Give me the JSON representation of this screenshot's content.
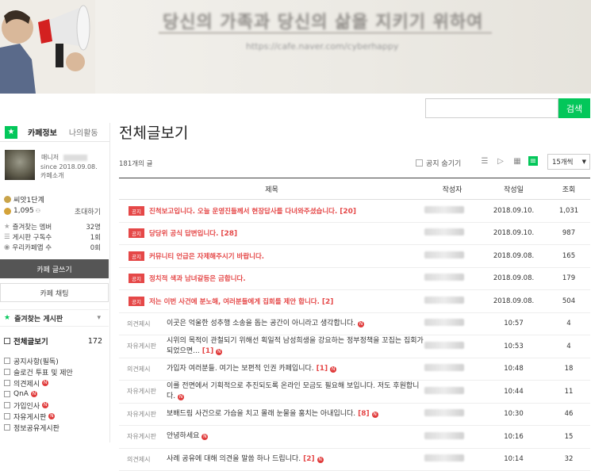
{
  "banner": {
    "title": "당신의 가족과 당신의 삶을 지키기 위하여",
    "url": "https://cafe.naver.com/cyberhappy"
  },
  "search": {
    "placeholder": "",
    "button_label": "검색"
  },
  "sidebar": {
    "tabs": [
      {
        "label": "카페정보"
      },
      {
        "label": "나의활동"
      }
    ],
    "manager_label": "매니저",
    "since": "since 2018.09.08.",
    "intro_link": "카페소개",
    "level": "씨앗1단계",
    "members": "1,095",
    "invite": "초대하기",
    "stats": [
      {
        "label": "즐겨찾는 멤버",
        "value": "32명"
      },
      {
        "label": "게시판 구독수",
        "value": "1회"
      },
      {
        "label": "우리카페앱 수",
        "value": "0회"
      }
    ],
    "write_button": "카페 글쓰기",
    "chat_button": "카페 채팅",
    "fav_header": "즐겨찾는 게시판",
    "board_all": {
      "label": "전체글보기",
      "count": "172"
    },
    "boards": [
      "공지사항(필독)",
      "슬로건 투표 및 제안",
      "의견제시",
      "QnA",
      "가입인사",
      "자유게시판",
      "정보공유게시판"
    ]
  },
  "main": {
    "title": "전체글보기",
    "count": "181개의 글",
    "hide_notice": "공지 숨기기",
    "page_size": "15개씩",
    "columns": [
      "제목",
      "작성자",
      "작성일",
      "조회"
    ],
    "notice_tag": "공지",
    "notices": [
      {
        "title": "진척보고입니다. 오늘 운영진들께서 현장답사를 다녀와주셨습니다.",
        "comments": "[20]",
        "date": "2018.09.10.",
        "views": "1,031"
      },
      {
        "title": "당당위 공식 답변입니다.",
        "comments": "[28]",
        "date": "2018.09.10.",
        "views": "987"
      },
      {
        "title": "커뮤니티 언급은 자제해주시기 바랍니다.",
        "comments": "",
        "date": "2018.09.08.",
        "views": "165"
      },
      {
        "title": "정치적 색과 남녀갈등은 금합니다.",
        "comments": "",
        "date": "2018.09.08.",
        "views": "179"
      },
      {
        "title": "저는 이번 사건에 분노해, 여러분들에게 집회를 제안 합니다.",
        "comments": "[2]",
        "date": "2018.09.08.",
        "views": "504"
      }
    ],
    "posts": [
      {
        "cat": "의견제시",
        "title": "이곳은 억울한 성추행 소송을 돕는 공간이 아니라고 생각합니다.",
        "comments": "",
        "date": "10:57",
        "views": "4"
      },
      {
        "cat": "자유게시판",
        "title": "시위의 목적이 관철되기 위해선 획일적 남성희생을 강요하는 정부정책을 꼬집는 집회가 되었으면...",
        "comments": "[1]",
        "date": "10:53",
        "views": "4"
      },
      {
        "cat": "의견제시",
        "title": "가입자 여러분들. 여기는 보편적 인권 카페입니다.",
        "comments": "[1]",
        "date": "10:48",
        "views": "18"
      },
      {
        "cat": "자유게시판",
        "title": "이를 전면에서 기획적으로 추진되도록 온라인 모금도 필요해 보입니다. 저도 후원합니다.",
        "comments": "",
        "date": "10:44",
        "views": "11"
      },
      {
        "cat": "자유게시판",
        "title": "보배드림 사건으로 가슴을 치고 몰래 눈물을 훔치는 아내입니다.",
        "comments": "[8]",
        "date": "10:30",
        "views": "46"
      },
      {
        "cat": "자유게시판",
        "title": "안녕하세요",
        "comments": "",
        "date": "10:16",
        "views": "15"
      },
      {
        "cat": "의견제시",
        "title": "사례 공유에 대해 의견을 말씀 하나 드립니다.",
        "comments": "[2]",
        "date": "10:14",
        "views": "32"
      }
    ]
  },
  "colors": {
    "accent": "#03c75a",
    "notice_red": "#e54848"
  }
}
